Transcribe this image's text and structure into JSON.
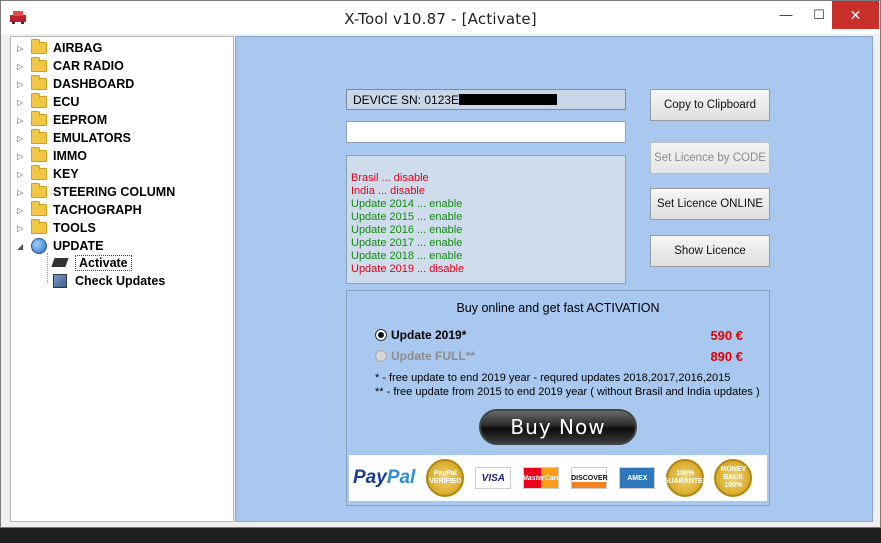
{
  "window": {
    "title": "X-Tool v10.87  -  [Activate]",
    "minimize_glyph": "—",
    "maximize_glyph": "☐",
    "close_glyph": "✕"
  },
  "tree": {
    "items": [
      {
        "label": "AIRBAG",
        "icon": "folder-icon"
      },
      {
        "label": "CAR RADIO",
        "icon": "folder-icon"
      },
      {
        "label": "DASHBOARD",
        "icon": "folder-icon"
      },
      {
        "label": "ECU",
        "icon": "folder-icon"
      },
      {
        "label": "EEPROM",
        "icon": "folder-icon"
      },
      {
        "label": "EMULATORS",
        "icon": "folder-icon"
      },
      {
        "label": "IMMO",
        "icon": "folder-icon"
      },
      {
        "label": "KEY",
        "icon": "folder-icon"
      },
      {
        "label": "STEERING COLUMN",
        "icon": "folder-icon"
      },
      {
        "label": "TACHOGRAPH",
        "icon": "folder-icon"
      },
      {
        "label": "TOOLS",
        "icon": "folder-icon"
      },
      {
        "label": "UPDATE",
        "icon": "globe-icon"
      }
    ],
    "children": [
      {
        "label": "Activate",
        "selected": true
      },
      {
        "label": "Check Updates",
        "selected": false
      }
    ]
  },
  "device": {
    "sn_label": "DEVICE SN: 0123E",
    "input_value": ""
  },
  "status": [
    {
      "text": "Brasil ... disable",
      "color": "#e0001a"
    },
    {
      "text": "India ... disable",
      "color": "#e0001a"
    },
    {
      "text": "Update 2014 ... enable",
      "color": "#138a12"
    },
    {
      "text": "Update 2015 ... enable",
      "color": "#138a12"
    },
    {
      "text": "Update 2016 ... enable",
      "color": "#138a12"
    },
    {
      "text": "Update 2017 ... enable",
      "color": "#138a12"
    },
    {
      "text": "Update 2018 ... enable",
      "color": "#138a12"
    },
    {
      "text": "Update 2019 ... disable",
      "color": "#e0001a"
    }
  ],
  "buttons": {
    "copy": "Copy to Clipboard",
    "licence_code": "Set Licence by CODE",
    "licence_online": "Set Licence ONLINE",
    "show_licence": "Show Licence"
  },
  "offer": {
    "title": "Buy online and get fast ACTIVATION",
    "options": [
      {
        "label": "Update 2019*",
        "price": "590 €",
        "selected": true
      },
      {
        "label": "Update FULL**",
        "price": "890 €",
        "selected": false
      }
    ],
    "note1": "*   - free update to end 2019 year - requred updates 2018,2017,2016,2015",
    "note2": "** - free update from 2015 to end 2019 year ( without Brasil and India updates )",
    "buy_label": "Buy Now"
  },
  "payments": {
    "paypal_a": "Pay",
    "paypal_b": "Pal",
    "verified": "PayPal VERIFIED",
    "visa": "VISA",
    "mastercard": "MasterCard",
    "discover": "DISCOVER",
    "amex": "AMEX",
    "seal1": "100% GUARANTEE",
    "seal2": "MONEY BACK 100%"
  },
  "colors": {
    "panel_bg": "#a8c8f0",
    "price_red": "#e00000",
    "enable_green": "#138a12",
    "disable_red": "#e0001a"
  }
}
